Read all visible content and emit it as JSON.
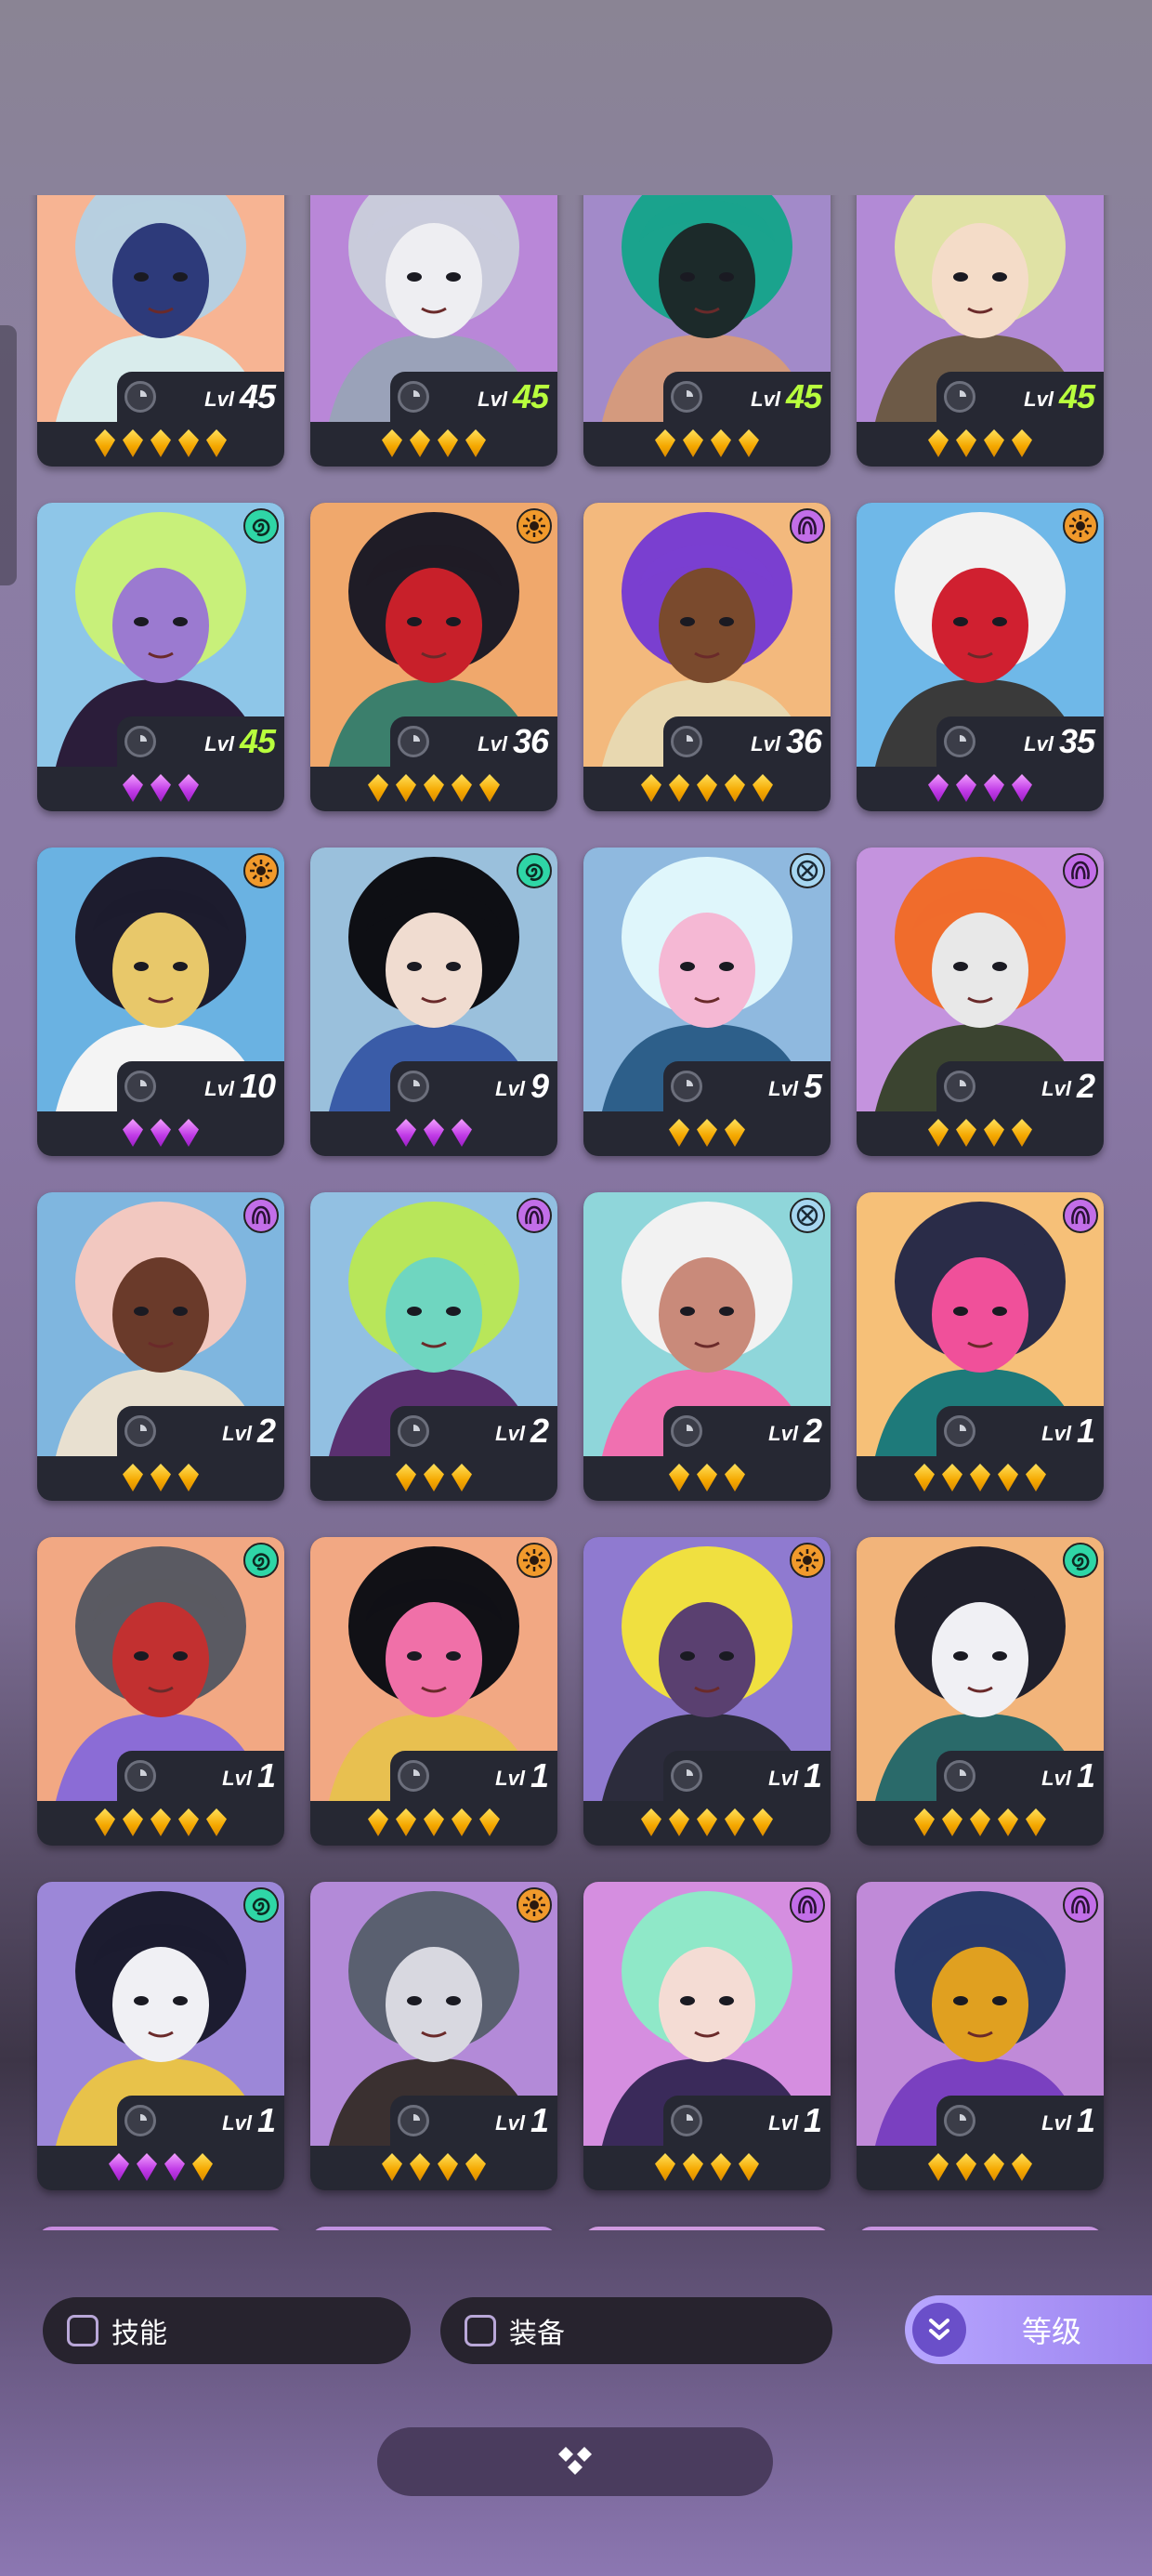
{
  "level_prefix": "Lvl",
  "filters": {
    "skill_label": "技能",
    "equipment_label": "装备",
    "sort_label": "等级"
  },
  "heroes": [
    {
      "level": "45",
      "max": false,
      "faction": "",
      "stars": 5,
      "gem": "gold",
      "palette": [
        "#f7b493",
        "#b7cfe0",
        "#2d3a7a",
        "#d9ecec"
      ]
    },
    {
      "level": "45",
      "max": true,
      "faction": "",
      "stars": 4,
      "gem": "gold",
      "palette": [
        "#b987d8",
        "#c9cbdb",
        "#eeeef2",
        "#9aa2b9"
      ]
    },
    {
      "level": "45",
      "max": true,
      "faction": "",
      "stars": 4,
      "gem": "gold",
      "palette": [
        "#a28ac9",
        "#1aa38d",
        "#1c2a2a",
        "#d49a7e"
      ]
    },
    {
      "level": "45",
      "max": true,
      "faction": "",
      "stars": 4,
      "gem": "gold",
      "palette": [
        "#b28ad6",
        "#e0e2a5",
        "#f4dcc8",
        "#6d5a47"
      ]
    },
    {
      "level": "45",
      "max": true,
      "faction": "swirl",
      "stars": 3,
      "gem": "purple",
      "palette": [
        "#8ec6e8",
        "#c8f07a",
        "#9b7ad0",
        "#2b1d3a"
      ]
    },
    {
      "level": "36",
      "max": false,
      "faction": "sun",
      "stars": 5,
      "gem": "gold",
      "palette": [
        "#f0a86c",
        "#1f1c26",
        "#c8202a",
        "#3b7f6c"
      ]
    },
    {
      "level": "36",
      "max": false,
      "faction": "wave",
      "stars": 5,
      "gem": "gold",
      "palette": [
        "#f3b97d",
        "#7a3fd0",
        "#7a4a2d",
        "#e8d8b0"
      ]
    },
    {
      "level": "35",
      "max": false,
      "faction": "sun",
      "stars": 4,
      "gem": "purple",
      "palette": [
        "#6fb8e8",
        "#f2f2f2",
        "#d02030",
        "#3a3a3a"
      ]
    },
    {
      "level": "10",
      "max": false,
      "faction": "sun",
      "stars": 3,
      "gem": "purple",
      "palette": [
        "#6ab2e2",
        "#1d1c2e",
        "#e8c86a",
        "#f4f4f4"
      ]
    },
    {
      "level": "9",
      "max": false,
      "faction": "swirl",
      "stars": 3,
      "gem": "purple",
      "palette": [
        "#9ac0dc",
        "#0e0f14",
        "#f0dcd0",
        "#3a5ca8"
      ]
    },
    {
      "level": "5",
      "max": false,
      "faction": "cross",
      "stars": 3,
      "gem": "gold",
      "palette": [
        "#8fb9df",
        "#dff6fb",
        "#f5b8d4",
        "#2d5f8a"
      ]
    },
    {
      "level": "2",
      "max": false,
      "faction": "wave",
      "stars": 4,
      "gem": "gold",
      "palette": [
        "#c493de",
        "#f06c2c",
        "#e8e8e8",
        "#3b4430"
      ]
    },
    {
      "level": "2",
      "max": false,
      "faction": "wave",
      "stars": 3,
      "gem": "gold",
      "palette": [
        "#7fb6df",
        "#f2c8c0",
        "#6a3a2a",
        "#e8e0d0"
      ]
    },
    {
      "level": "2",
      "max": false,
      "faction": "wave",
      "stars": 3,
      "gem": "gold",
      "palette": [
        "#92c0e2",
        "#b8e65a",
        "#6fd6c0",
        "#5a3070"
      ]
    },
    {
      "level": "2",
      "max": false,
      "faction": "cross",
      "stars": 3,
      "gem": "gold",
      "palette": [
        "#8fd6da",
        "#f2f2f2",
        "#c98a7a",
        "#f070b0"
      ]
    },
    {
      "level": "1",
      "max": false,
      "faction": "wave",
      "stars": 5,
      "gem": "gold",
      "palette": [
        "#f6c078",
        "#2a2c48",
        "#f0509a",
        "#1e7a7a"
      ]
    },
    {
      "level": "1",
      "max": false,
      "faction": "swirl",
      "stars": 5,
      "gem": "gold",
      "palette": [
        "#f2a883",
        "#5a5a62",
        "#c23030",
        "#8b6cd6"
      ]
    },
    {
      "level": "1",
      "max": false,
      "faction": "sun",
      "stars": 5,
      "gem": "gold",
      "palette": [
        "#f2a883",
        "#111116",
        "#f070a8",
        "#e8c050"
      ]
    },
    {
      "level": "1",
      "max": false,
      "faction": "sun",
      "stars": 5,
      "gem": "gold",
      "palette": [
        "#8f7ad0",
        "#f0e040",
        "#5a4070",
        "#2c2c3c"
      ]
    },
    {
      "level": "1",
      "max": false,
      "faction": "swirl",
      "stars": 5,
      "gem": "gold",
      "palette": [
        "#f2b47a",
        "#20202c",
        "#f0f0f4",
        "#2a6a6a"
      ]
    },
    {
      "level": "1",
      "max": false,
      "faction": "swirl",
      "stars": 4,
      "gem": "mixed",
      "palette": [
        "#9c87d8",
        "#1c1c30",
        "#f0f0f4",
        "#e8c24a"
      ]
    },
    {
      "level": "1",
      "max": false,
      "faction": "sun",
      "stars": 4,
      "gem": "gold",
      "palette": [
        "#b38ad8",
        "#5a6070",
        "#d8d8e0",
        "#3a3030"
      ]
    },
    {
      "level": "1",
      "max": false,
      "faction": "wave",
      "stars": 4,
      "gem": "gold",
      "palette": [
        "#d58ee0",
        "#8fe8c8",
        "#f4dcd4",
        "#3a2a5a"
      ]
    },
    {
      "level": "1",
      "max": false,
      "faction": "wave",
      "stars": 4,
      "gem": "gold",
      "palette": [
        "#c08ad8",
        "#2a3a6a",
        "#e0a020",
        "#7a40c0"
      ]
    },
    {
      "level": "",
      "max": false,
      "faction": "wave",
      "stars": 0,
      "gem": "gold",
      "palette": [
        "#c98ce0",
        "#f08aa8",
        "#5a3a60",
        "#e8c0c0"
      ]
    },
    {
      "level": "",
      "max": false,
      "faction": "sun",
      "stars": 0,
      "gem": "gold",
      "palette": [
        "#c292e2",
        "#e8f0f0",
        "#a0c8d8",
        "#7a7a8a"
      ]
    },
    {
      "level": "",
      "max": false,
      "faction": "swirl",
      "stars": 0,
      "gem": "gold",
      "palette": [
        "#d09ae0",
        "#2a2a36",
        "#f0f0f0",
        "#6a6a78"
      ]
    },
    {
      "level": "",
      "max": false,
      "faction": "sun",
      "stars": 0,
      "gem": "gold",
      "palette": [
        "#c894e0",
        "#1a1a24",
        "#b8d830",
        "#5a5a70"
      ]
    }
  ]
}
